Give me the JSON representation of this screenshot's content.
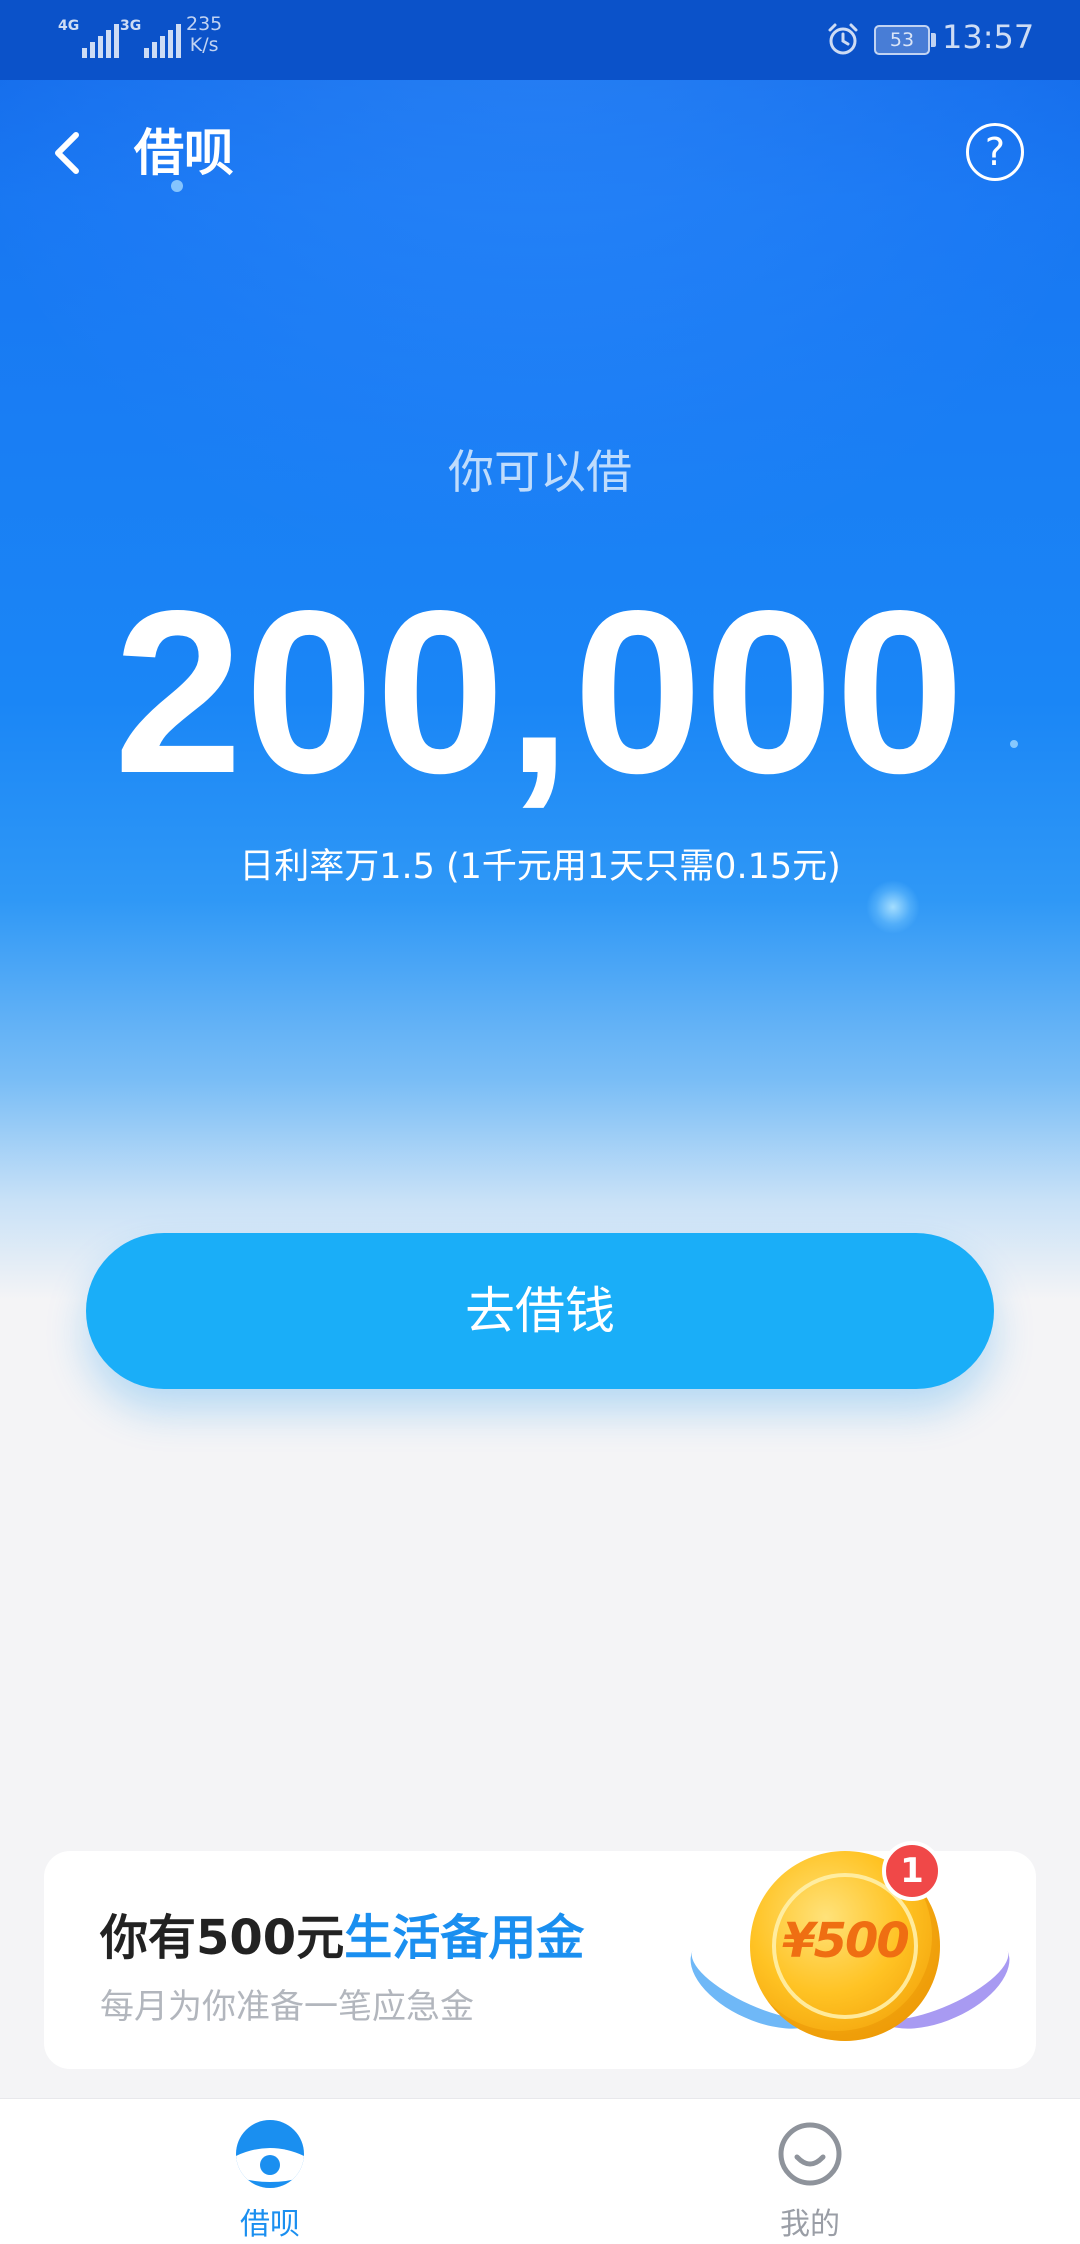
{
  "status_bar": {
    "signal1": "4G",
    "signal2": "3G",
    "net_speed_value": "235",
    "net_speed_unit": "K/s",
    "battery": "53",
    "time": "13:57"
  },
  "header": {
    "title": "借呗",
    "back_icon": "chevron-left-icon",
    "help_label": "?"
  },
  "main": {
    "subtitle": "你可以借",
    "amount": "200,000",
    "rate_text": "日利率万1.5 (1千元用1天只需0.15元)",
    "borrow_button_label": "去借钱"
  },
  "promo": {
    "title_prefix": "你有500元",
    "title_highlight": "生活备用金",
    "subtitle": "每月为你准备一笔应急金",
    "coin_label": "¥500",
    "badge_count": "1"
  },
  "tab_bar": {
    "tabs": [
      {
        "label": "借呗",
        "icon": "jiebei-icon",
        "active": true
      },
      {
        "label": "我的",
        "icon": "smiley-icon",
        "active": false
      }
    ]
  },
  "colors": {
    "primary_blue": "#1877f2",
    "button_blue": "#1aaef8",
    "highlight_blue": "#1a8ff0",
    "badge_red": "#f04848",
    "inactive_gray": "#9a9ea6"
  }
}
